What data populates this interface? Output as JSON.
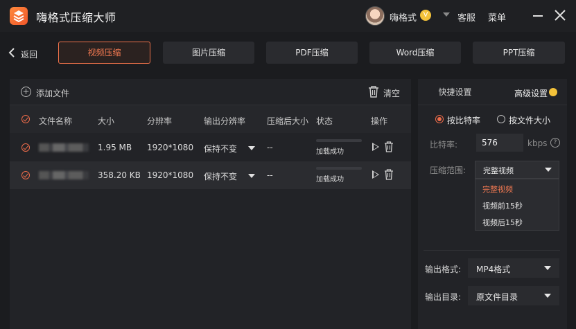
{
  "app": {
    "title": "嗨格式压缩大师"
  },
  "user": {
    "name": "嗨格式",
    "vip": "V"
  },
  "header": {
    "service": "客服",
    "menu": "菜单"
  },
  "nav": {
    "back": "返回"
  },
  "tabs": [
    {
      "label": "视频压缩",
      "active": true
    },
    {
      "label": "图片压缩",
      "active": false
    },
    {
      "label": "PDF压缩",
      "active": false
    },
    {
      "label": "Word压缩",
      "active": false
    },
    {
      "label": "PPT压缩",
      "active": false
    }
  ],
  "toolbar": {
    "add_file": "添加文件",
    "clear": "清空"
  },
  "table": {
    "columns": [
      "文件名称",
      "大小",
      "分辨率",
      "输出分辨率",
      "压缩后大小",
      "状态",
      "操作"
    ],
    "rows": [
      {
        "size": "1.95 MB",
        "resolution": "1920*1080",
        "output_resolution": "保持不变",
        "compressed_size": "--",
        "status": "加载成功"
      },
      {
        "size": "358.20 KB",
        "resolution": "1920*1080",
        "output_resolution": "保持不变",
        "compressed_size": "--",
        "status": "加载成功"
      }
    ]
  },
  "settings": {
    "tabs": {
      "quick": "快捷设置",
      "advanced": "高级设置"
    },
    "mode": {
      "bitrate": "按比特率",
      "filesize": "按文件大小",
      "selected": "bitrate"
    },
    "bitrate": {
      "label": "比特率:",
      "value": "576",
      "unit": "kbps",
      "help": "?"
    },
    "range": {
      "label": "压缩范围:",
      "value": "完整视频",
      "options": [
        "完整视频",
        "视频前15秒",
        "视频后15秒"
      ]
    },
    "output_format": {
      "label": "输出格式:",
      "value": "MP4格式"
    },
    "output_dir": {
      "label": "输出目录:",
      "value": "原文件目录"
    }
  },
  "colors": {
    "accent": "#f0724a",
    "vip": "#f3c23a",
    "background": "#1b1c1f"
  }
}
